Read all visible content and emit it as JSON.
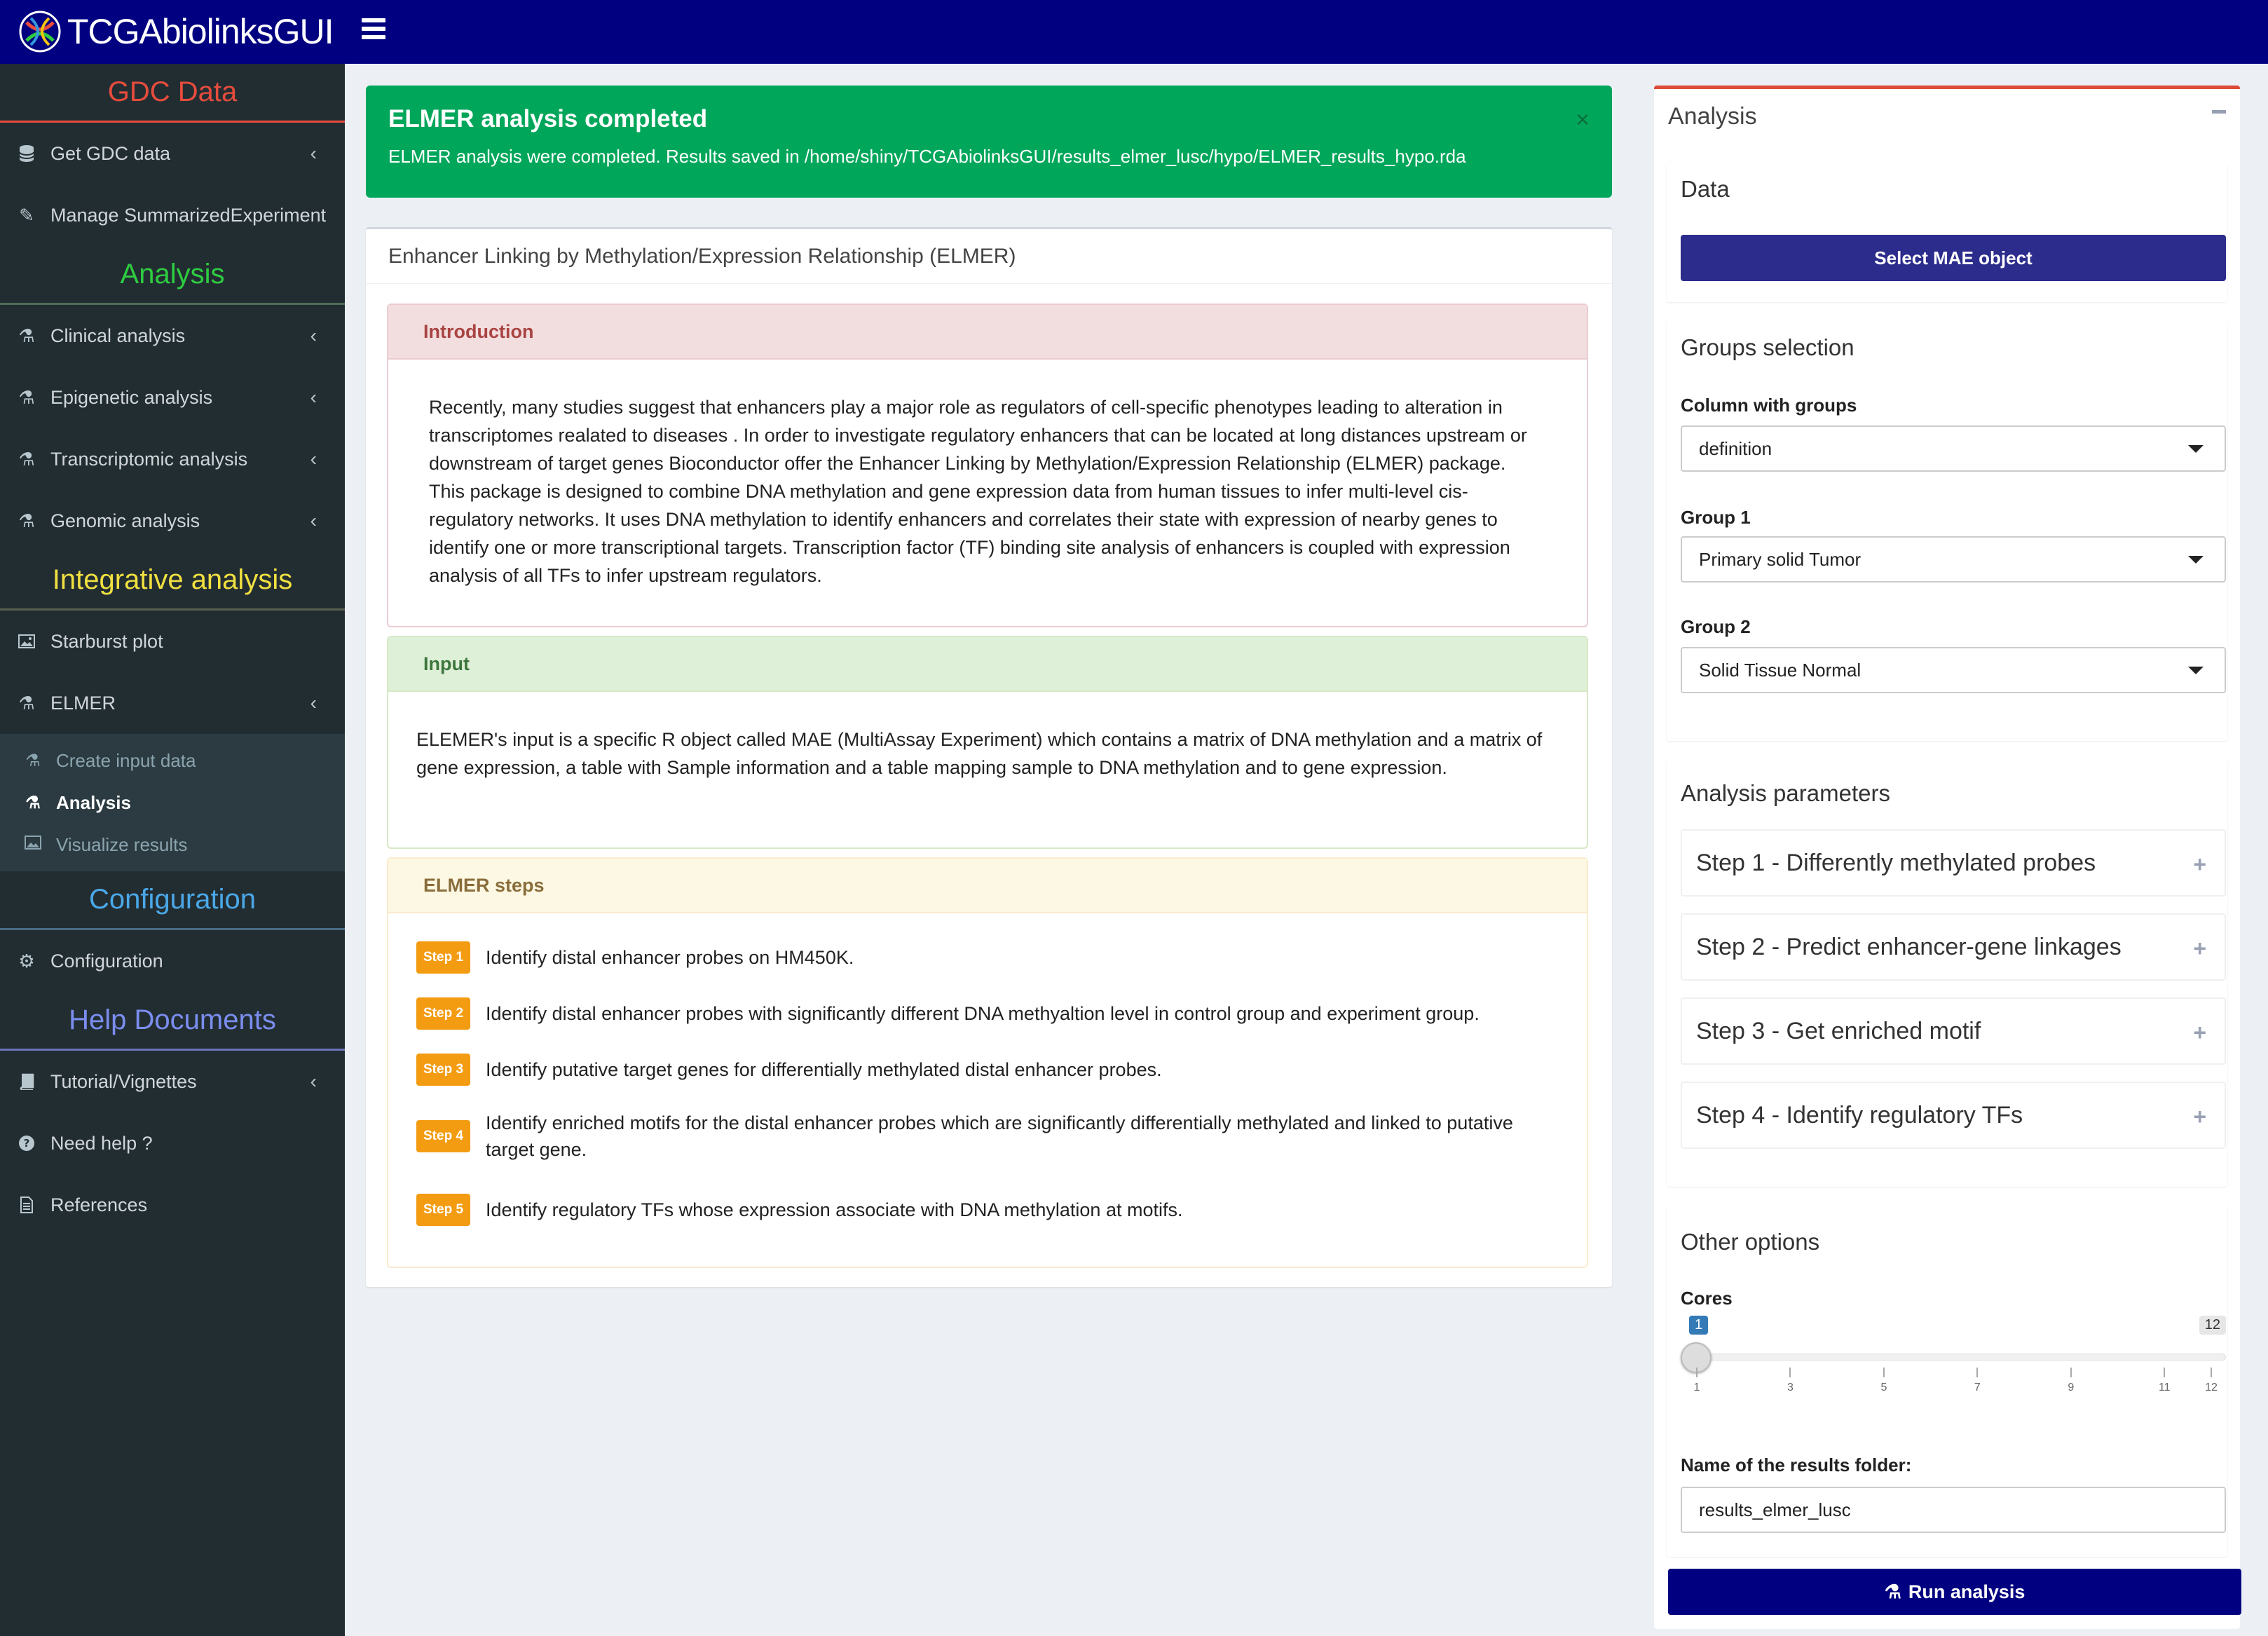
{
  "app": {
    "title": "TCGAbiolinksGUI"
  },
  "sidebar": {
    "sections": {
      "gdc": "GDC Data",
      "analysis": "Analysis",
      "integrative": "Integrative analysis",
      "configuration": "Configuration",
      "help": "Help Documents"
    },
    "items": {
      "get_gdc_data": "Get GDC data",
      "manage_se": "Manage SummarizedExperiment",
      "clinical": "Clinical analysis",
      "epigenetic": "Epigenetic analysis",
      "transcriptomic": "Transcriptomic analysis",
      "genomic": "Genomic analysis",
      "starburst": "Starburst plot",
      "elmer": "ELMER",
      "create_input": "Create input data",
      "analysis": "Analysis",
      "visualize": "Visualize results",
      "configuration": "Configuration",
      "tutorial": "Tutorial/Vignettes",
      "need_help": "Need help ?",
      "references": "References"
    }
  },
  "alert": {
    "title": "ELMER analysis completed",
    "message": "ELMER analysis were completed. Results saved in /home/shiny/TCGAbiolinksGUI/results_elmer_lusc/hypo/ELMER_results_hypo.rda",
    "close": "×"
  },
  "main": {
    "title": "Enhancer Linking by Methylation/Expression Relationship (ELMER)",
    "intro": {
      "heading": "Introduction",
      "text": "Recently, many studies suggest that enhancers play a major role as regulators of cell-specific phenotypes leading to alteration in transcriptomes realated to diseases . In order to investigate regulatory enhancers that can be located at long distances upstream or downstream of target genes Bioconductor offer the Enhancer Linking by Methylation/Expression Relationship (ELMER) package. This package is designed to combine DNA methylation and gene expression data from human tissues to infer multi-level cis-regulatory networks. It uses DNA methylation to identify enhancers and correlates their state with expression of nearby genes to identify one or more transcriptional targets. Transcription factor (TF) binding site analysis of enhancers is coupled with expression analysis of all TFs to infer upstream regulators."
    },
    "input": {
      "heading": "Input",
      "text": "ELEMER's input is a specific R object called MAE (MultiAssay Experiment) which contains a matrix of DNA methylation and a matrix of gene expression, a table with Sample information and a table mapping sample to DNA methylation and to gene expression."
    },
    "steps": {
      "heading": "ELMER steps",
      "items": [
        {
          "badge": "Step 1",
          "text": "Identify distal enhancer probes on HM450K."
        },
        {
          "badge": "Step 2",
          "text": "Identify distal enhancer probes with significantly different DNA methyaltion level in control group and experiment group."
        },
        {
          "badge": "Step 3",
          "text": "Identify putative target genes for differentially methylated distal enhancer probes."
        },
        {
          "badge": "Step 4",
          "text": "Identify enriched motifs for the distal enhancer probes which are significantly differentially methylated and linked to putative target gene."
        },
        {
          "badge": "Step 5",
          "text": "Identify regulatory TFs whose expression associate with DNA methylation at motifs."
        }
      ]
    }
  },
  "right": {
    "title": "Analysis",
    "data": {
      "title": "Data",
      "button": "Select MAE object"
    },
    "groups": {
      "title": "Groups selection",
      "column_label": "Column with groups",
      "column_value": "definition",
      "group1_label": "Group 1",
      "group1_value": "Primary solid Tumor",
      "group2_label": "Group 2",
      "group2_value": "Solid Tissue Normal"
    },
    "params": {
      "title": "Analysis parameters",
      "step1": "Step 1 - Differently methylated probes",
      "step2": "Step 2 - Predict enhancer-gene linkages",
      "step3": "Step 3 - Get enriched motif",
      "step4": "Step 4 - Identify regulatory TFs"
    },
    "other": {
      "title": "Other options",
      "cores_label": "Cores",
      "cores_value": 1,
      "cores_min": 1,
      "cores_max": 12,
      "ticks": [
        "1",
        "3",
        "5",
        "7",
        "9",
        "11",
        "12"
      ],
      "folder_label": "Name of the results folder:",
      "folder_value": "results_elmer_lusc"
    },
    "run_button": "Run analysis"
  }
}
